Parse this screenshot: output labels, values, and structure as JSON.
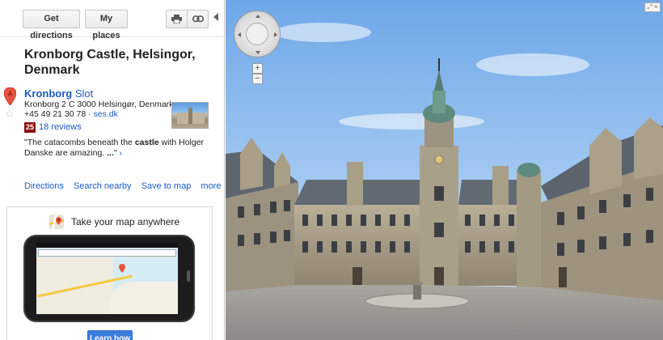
{
  "toolbar": {
    "get_directions_label": "Get directions",
    "my_places_label": "My places",
    "print_icon": "print-icon",
    "link_icon": "link-icon",
    "collapse_icon": "collapse-left-icon"
  },
  "place": {
    "title": "Kronborg Castle, Helsingor, Denmark",
    "name_bold": "Kronborg",
    "name_rest": " Slot",
    "address": "Kronborg 2 C 3000 Helsingør, Denmark",
    "phone": "+45 49 21 30 78",
    "separator": " · ",
    "website": "ses.dk",
    "rating": "25",
    "reviews": "18 reviews",
    "snippet_before": "\"The catacombs beneath the ",
    "snippet_bold": "castle",
    "snippet_after": " with Holger Danske are amazing. ",
    "snippet_ellipsis": "...",
    "snippet_close": "\"",
    "snippet_more": " ›",
    "marker_letter": "A"
  },
  "actions": {
    "directions": "Directions",
    "search_nearby": "Search nearby",
    "save_to_map": "Save to map",
    "more": "more"
  },
  "promo": {
    "title": "Take your map anywhere",
    "learn_more": "Learn how"
  },
  "streetview": {
    "zoom_in": "+",
    "zoom_out": "−",
    "fullscreen": "⤢ ×"
  },
  "colors": {
    "link": "#1a5bc4",
    "rating_bg": "#8b1212",
    "button_blue": "#3b7ddd"
  }
}
